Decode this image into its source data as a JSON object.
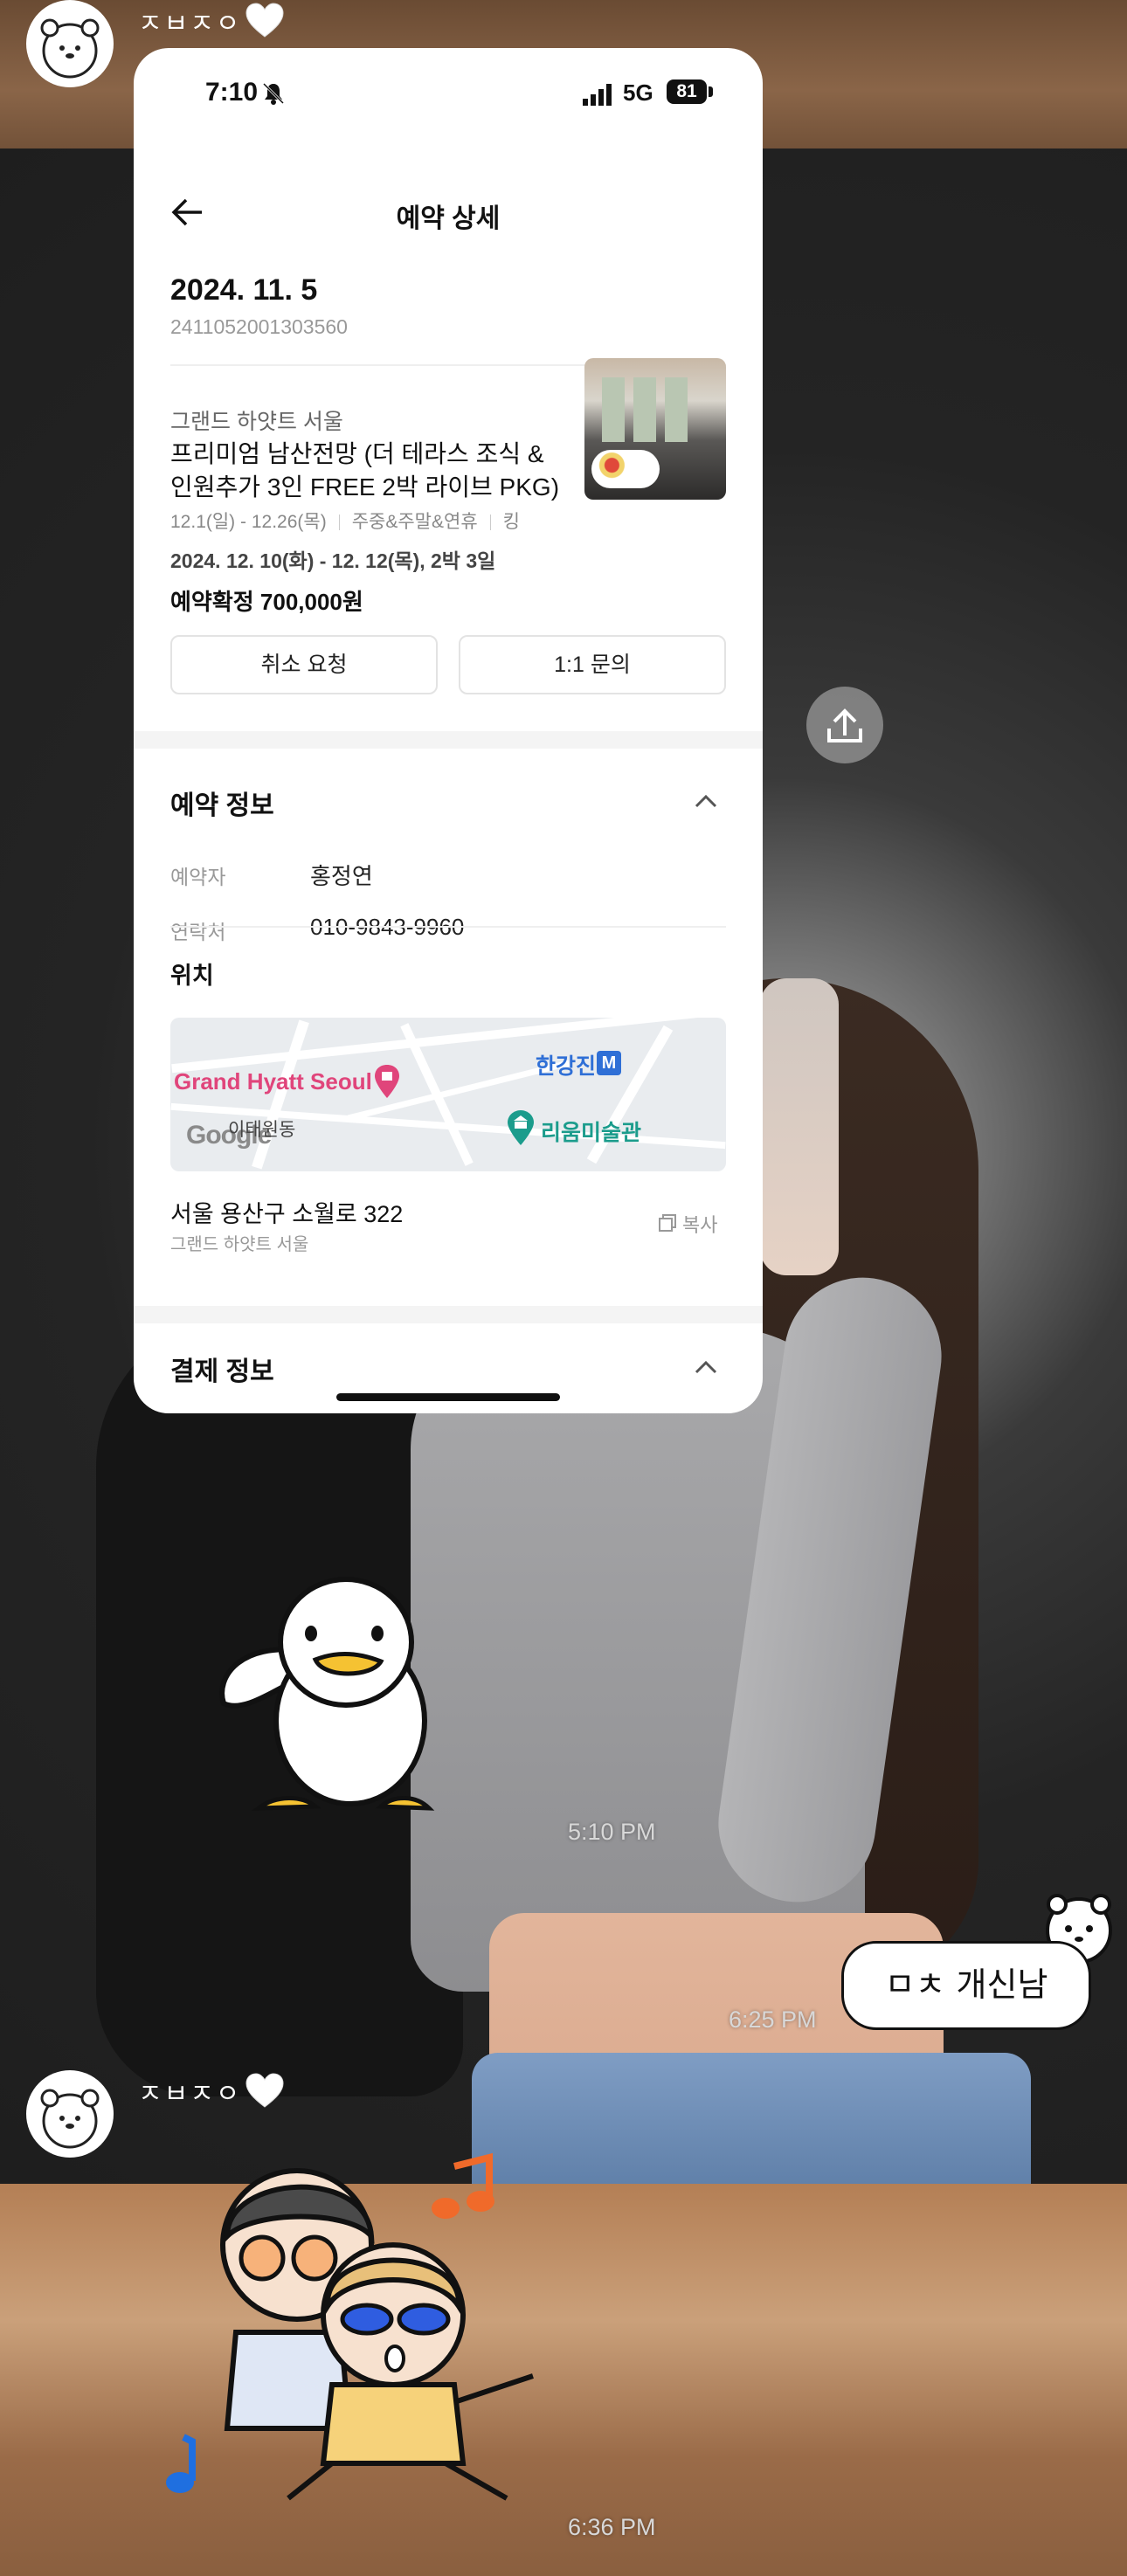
{
  "chat": {
    "messages": [
      {
        "sender": "ㅈㅂㅈㅇ",
        "type": "image"
      },
      {
        "time": "5:10 PM"
      },
      {
        "time": "6:25 PM",
        "sticker_text": "ㅁㅊ 개신남"
      },
      {
        "sender": "ㅈㅂㅈㅇ",
        "type": "sticker"
      },
      {
        "time": "6:36 PM"
      }
    ]
  },
  "screenshot": {
    "status_time": "7:10",
    "network": "5G",
    "battery": "81",
    "nav_title": "예약 상세",
    "date": "2024. 11. 5",
    "order_number": "2411052001303560",
    "hotel": "그랜드 하얏트 서울",
    "package": "프리미엄 남산전망 (더 테라스 조식 & 인원추가 3인 FREE 2박 라이브 PKG)",
    "sale_period": "12.1(일) - 12.26(목)",
    "day_type": "주중&주말&연휴",
    "room_type": "킹",
    "stay": "2024. 12. 10(화) - 12. 12(목), 2박 3일",
    "status_price": "예약확정 700,000원",
    "cancel_button": "취소 요청",
    "inquiry_button": "1:1 문의",
    "booking_info_title": "예약 정보",
    "booker_label": "예약자",
    "booker_value": "홍정연",
    "contact_label": "연락처",
    "contact_value": "010-9843-9960",
    "location_title": "위치",
    "map": {
      "hotel_label": "Grand Hyatt Seoul",
      "station_label": "한강진",
      "metro_badge": "M",
      "museum_label": "리움미술관",
      "district_label": "이태원동",
      "google_label": "Google"
    },
    "address": "서울 용산구 소월로 322",
    "address_sub": "그랜드 하얏트 서울",
    "copy_label": "복사",
    "payment_info_title": "결제 정보"
  },
  "icons": {
    "back": "arrow-left-icon",
    "share": "share-icon",
    "chevron": "chevron-up-icon",
    "copy": "copy-icon",
    "heart": "white-heart-icon"
  },
  "colors": {
    "hotel_map_label": "#e0457b",
    "metro": "#2f6fd6",
    "museum": "#1b9c8c"
  }
}
